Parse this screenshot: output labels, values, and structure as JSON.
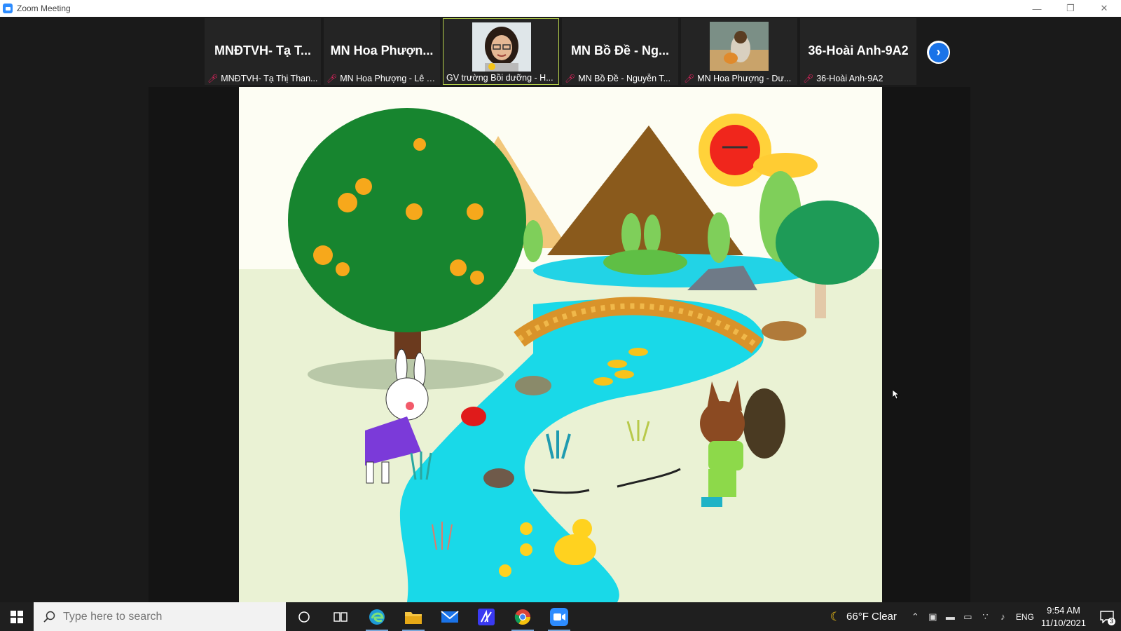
{
  "window": {
    "title": "Zoom Meeting",
    "controls": [
      "minimize",
      "restore",
      "close"
    ]
  },
  "participants": [
    {
      "big_name": "MNĐTVH- Tạ T...",
      "label": "MNĐTVH- Tạ Thị Than...",
      "muted": true,
      "has_video": false
    },
    {
      "big_name": "MN Hoa Phượn...",
      "label": "MN Hoa Phượng - Lê T...",
      "muted": true,
      "has_video": false
    },
    {
      "big_name": "",
      "label": "GV trường Bồi dưỡng - H...",
      "muted": false,
      "has_video": true,
      "active_speaker": true
    },
    {
      "big_name": "MN Bồ Đề - Ng...",
      "label": "MN Bồ Đề - Nguyễn T...",
      "muted": true,
      "has_video": false
    },
    {
      "big_name": "",
      "label": "MN Hoa Phượng - Dư...",
      "muted": true,
      "has_video": true
    },
    {
      "big_name": "36-Hoài Anh-9A2",
      "label": "36-Hoài Anh-9A2",
      "muted": true,
      "has_video": false
    }
  ],
  "next_page_icon": "chevron-right-icon",
  "shared_content": {
    "kind": "illustration"
  },
  "taskbar": {
    "search_placeholder": "Type here to search",
    "apps": [
      "cortana",
      "task-view",
      "edge",
      "file-explorer",
      "mail",
      "text-editor",
      "chrome",
      "zoom"
    ],
    "weather": "66°F Clear",
    "language": "ENG",
    "time": "9:54 AM",
    "date": "11/10/2021",
    "notification_count": "3"
  },
  "colors": {
    "zoom_blue": "#2d8cff",
    "active_border": "#b6d14a",
    "mic_muted": "#e0245e",
    "taskbar": "#1f1f1f"
  }
}
